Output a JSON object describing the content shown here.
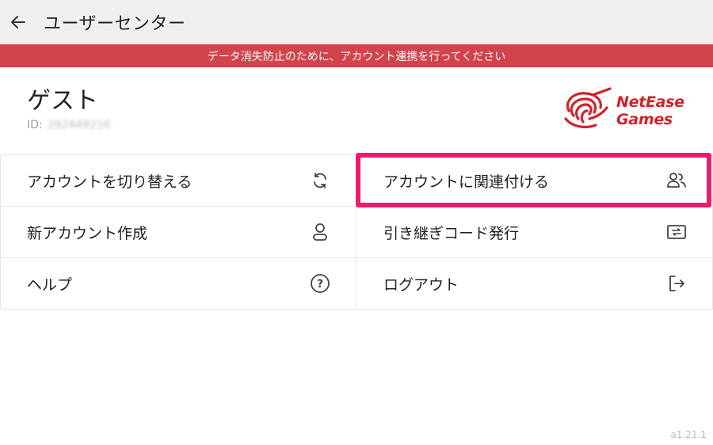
{
  "header": {
    "title": "ユーザーセンター",
    "back_icon": "arrow-left-icon"
  },
  "banner": {
    "text": "データ消失防止のために、アカウント連携を行ってください",
    "color": "#d1444b"
  },
  "user": {
    "name": "ゲスト",
    "id_label": "ID:",
    "id_value": "292449216"
  },
  "logo": {
    "line1": "NetEase",
    "line2": "Games",
    "color": "#d1222b"
  },
  "menu": {
    "items": [
      {
        "label": "アカウントを切り替える",
        "icon": "refresh-icon"
      },
      {
        "label": "アカウントに関連付ける",
        "icon": "link-users-icon",
        "highlighted": true
      },
      {
        "label": "新アカウント作成",
        "icon": "user-icon"
      },
      {
        "label": "引き継ぎコード発行",
        "icon": "ticket-icon"
      },
      {
        "label": "ヘルプ",
        "icon": "help-icon"
      },
      {
        "label": "ログアウト",
        "icon": "logout-icon"
      }
    ]
  },
  "highlight_color": "#ec1c6a",
  "version": "a1.21.1"
}
